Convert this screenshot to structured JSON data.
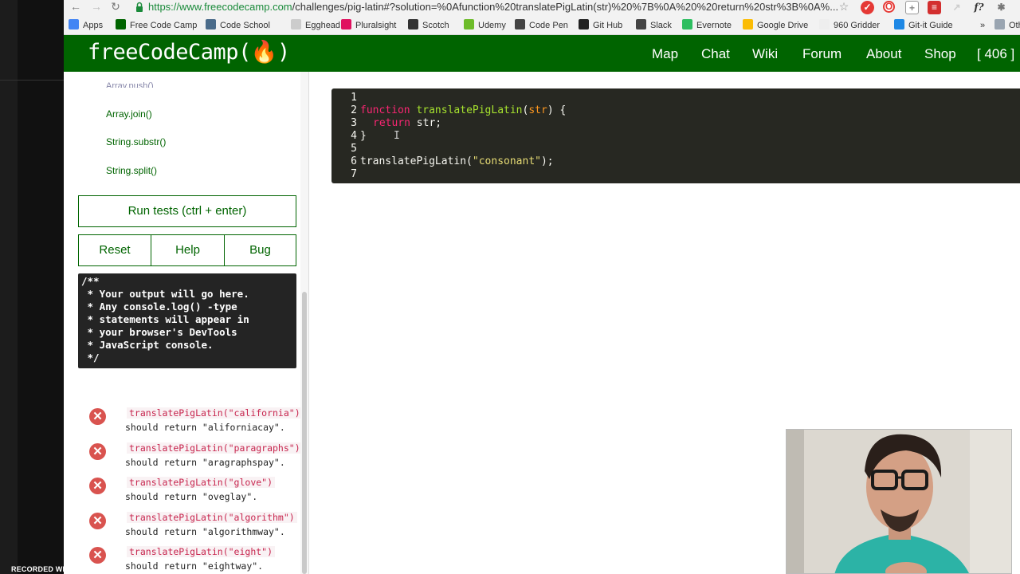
{
  "browser": {
    "url_host": "https://www.freecodecamp.com",
    "url_path": "/challenges/pig-latin#?solution=%0Afunction%20translatePigLatin(str)%20%7B%0A%20%20return%20str%3B%0A%...",
    "nav": {
      "back": "←",
      "forward": "→",
      "reload": "↻"
    },
    "bookmarks": [
      {
        "label": "Apps",
        "icon": "apps-icon",
        "color": "#4285f4"
      },
      {
        "label": "Free Code Camp",
        "icon": "freecodecamp-icon",
        "color": "#006400"
      },
      {
        "label": "Code School",
        "icon": "codeschool-icon",
        "color": "#4a6b8a"
      },
      {
        "label": "Egghead",
        "icon": "egghead-icon",
        "color": "#cccccc"
      },
      {
        "label": "Pluralsight",
        "icon": "pluralsight-icon",
        "color": "#e0115f"
      },
      {
        "label": "Scotch",
        "icon": "scotch-icon",
        "color": "#333333"
      },
      {
        "label": "Udemy",
        "icon": "udemy-icon",
        "color": "#6dbc2a"
      },
      {
        "label": "Code Pen",
        "icon": "codepen-icon",
        "color": "#444444"
      },
      {
        "label": "Git Hub",
        "icon": "github-icon",
        "color": "#222222"
      },
      {
        "label": "Slack",
        "icon": "slack-icon",
        "color": "#444444"
      },
      {
        "label": "Evernote",
        "icon": "evernote-icon",
        "color": "#2dbe60"
      },
      {
        "label": "Google Drive",
        "icon": "google-drive-icon",
        "color": "#fbbc05"
      },
      {
        "label": "960 Gridder",
        "icon": "page-icon",
        "color": "#eeeeee"
      },
      {
        "label": "Git-it Guide",
        "icon": "gitit-icon",
        "color": "#1e88e5"
      },
      {
        "label": "»",
        "icon": "more-icon",
        "color": "#f2f2f2"
      },
      {
        "label": "Oth",
        "icon": "folder-icon",
        "color": "#9aa5b1"
      }
    ]
  },
  "fcc": {
    "logo": "freeCodeCamp(🔥)",
    "nav": [
      "Map",
      "Chat",
      "Wiki",
      "Forum",
      "About",
      "Shop",
      "[ 406 ]"
    ]
  },
  "sidebar": {
    "links": [
      "Array.join()",
      "String.substr()",
      "String.split()"
    ],
    "run_tests": "Run tests (ctrl + enter)",
    "reset": "Reset",
    "help": "Help",
    "bug": "Bug",
    "output": "/**\n * Your output will go here.\n * Any console.log() -type\n * statements will appear in\n * your browser's DevTools\n * JavaScript console.\n */",
    "tests": [
      {
        "call": "translatePigLatin(\"california\")",
        "ret": "should return \"aliforniacay\"."
      },
      {
        "call": "translatePigLatin(\"paragraphs\")",
        "ret": "should return \"aragraphspay\"."
      },
      {
        "call": "translatePigLatin(\"glove\")",
        "ret": "should return \"oveglay\"."
      },
      {
        "call": "translatePigLatin(\"algorithm\")",
        "ret": "should return \"algorithmway\"."
      },
      {
        "call": "translatePigLatin(\"eight\")",
        "ret": "should return \"eightway\"."
      }
    ]
  },
  "editor": {
    "line_numbers": [
      "1",
      "2",
      "3",
      "4",
      "5",
      "6",
      "7"
    ],
    "kw_function": "function",
    "fn_name": "translatePigLatin",
    "paren_open": "(",
    "param": "str",
    "sig_close": ") {",
    "kw_return": "return",
    "return_rest": " str;",
    "close_brace": "}",
    "call": "translatePigLatin(",
    "call_str": "\"consonant\"",
    "call_end": ");"
  },
  "recorder": "RECORDED WITH"
}
